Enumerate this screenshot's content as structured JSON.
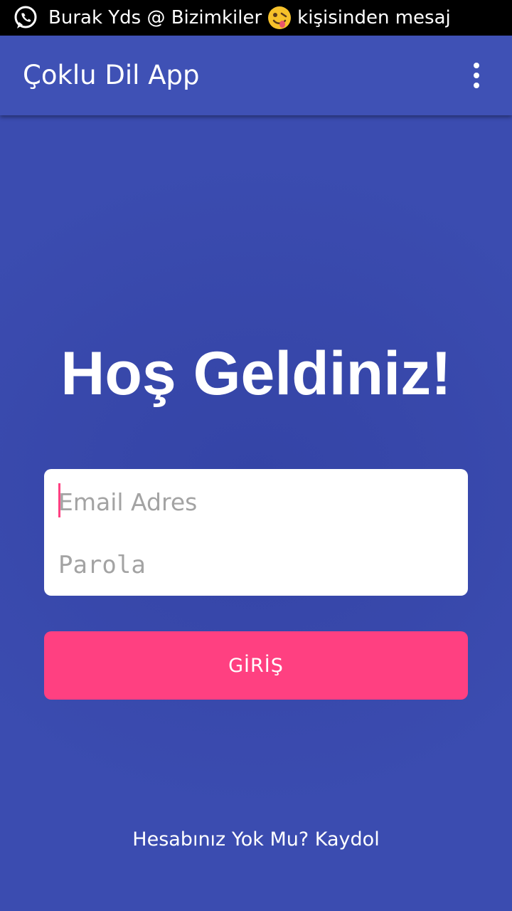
{
  "status_bar": {
    "notification_icon": "whatsapp-icon",
    "sender": "Burak Yds @ Bizimkiler",
    "emoji_icon": "zany-face-emoji-icon",
    "message_suffix": "kişisinden mesaj"
  },
  "app_bar": {
    "title": "Çoklu Dil App",
    "overflow_icon": "more-vert-icon"
  },
  "main": {
    "welcome_title": "Hoş Geldiniz!",
    "email_field": {
      "placeholder": "Email Adres",
      "value": ""
    },
    "password_field": {
      "placeholder": "Parola",
      "value": ""
    },
    "login_button_label": "GİRİŞ",
    "signup_link": "Hesabınız Yok Mu? Kaydol"
  },
  "colors": {
    "primary": "#3f51b5",
    "background": "#3b4cb0",
    "accent": "#ff4081",
    "status_bar": "#000000"
  }
}
